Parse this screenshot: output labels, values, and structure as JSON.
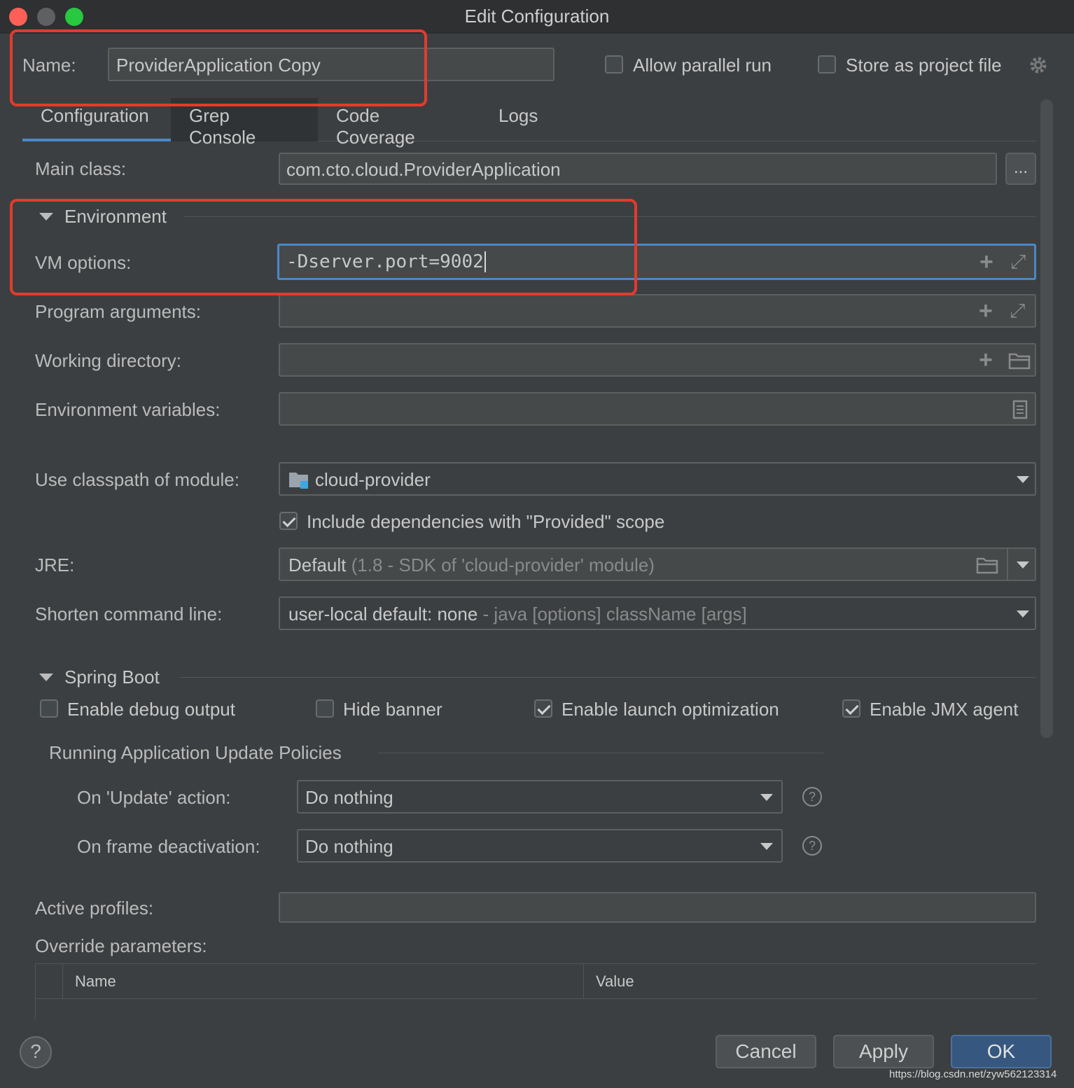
{
  "window": {
    "title": "Edit Configuration"
  },
  "header": {
    "name_label": "Name:",
    "name_value": "ProviderApplication Copy",
    "allow_parallel_label": "Allow parallel run",
    "store_project_label": "Store as project file"
  },
  "tabs": [
    {
      "label": "Configuration",
      "active": true
    },
    {
      "label": "Grep Console",
      "active": false
    },
    {
      "label": "Code Coverage",
      "active": false
    },
    {
      "label": "Logs",
      "active": false
    }
  ],
  "form": {
    "main_class_label": "Main class:",
    "main_class_value": "com.cto.cloud.ProviderApplication",
    "browse_label": "...",
    "environment_section": "Environment",
    "vm_options_label": "VM options:",
    "vm_options_value": "-Dserver.port=9002",
    "program_args_label": "Program arguments:",
    "working_dir_label": "Working directory:",
    "env_vars_label": "Environment variables:",
    "classpath_label": "Use classpath of module:",
    "classpath_value": "cloud-provider",
    "include_deps_label": "Include dependencies with \"Provided\" scope",
    "jre_label": "JRE:",
    "jre_value": "Default",
    "jre_detail": "(1.8 - SDK of 'cloud-provider' module)",
    "shorten_label": "Shorten command line:",
    "shorten_value": "user-local default: none",
    "shorten_detail": "- java [options] className [args]"
  },
  "spring_boot": {
    "section": "Spring Boot",
    "enable_debug_label": "Enable debug output",
    "hide_banner_label": "Hide banner",
    "launch_opt_label": "Enable launch optimization",
    "jmx_label": "Enable JMX agent",
    "policies_section": "Running Application Update Policies",
    "on_update_label": "On 'Update' action:",
    "on_update_value": "Do nothing",
    "on_frame_label": "On frame deactivation:",
    "on_frame_value": "Do nothing",
    "help_glyph": "?",
    "active_profiles_label": "Active profiles:",
    "override_label": "Override parameters:",
    "table_columns": [
      "Name",
      "Value"
    ]
  },
  "footer": {
    "help_glyph": "?",
    "cancel_label": "Cancel",
    "apply_label": "Apply",
    "ok_label": "OK",
    "watermark": "https://blog.csdn.net/zyw562123314"
  },
  "colors": {
    "background": "#3c3f41",
    "accent": "#4a88c7",
    "annotation_red": "#e43a2e"
  }
}
